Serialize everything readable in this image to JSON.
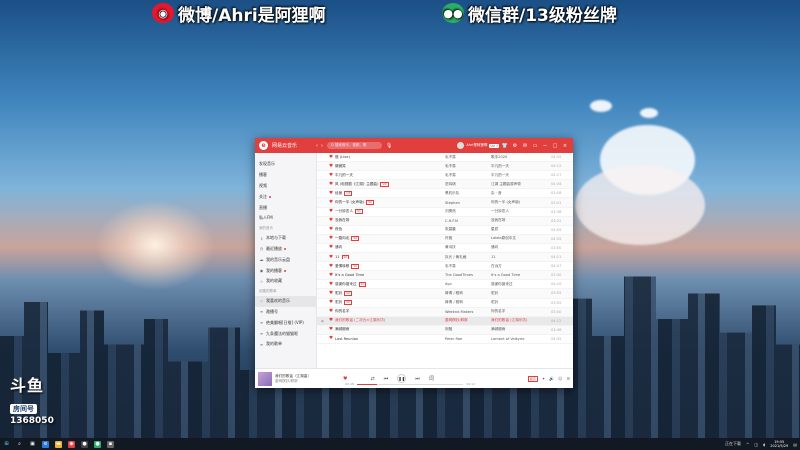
{
  "banner": {
    "weibo": "微博/Ahri是阿狸啊",
    "wechat": "微信群/13级粉丝牌"
  },
  "app": {
    "title": "网易云音乐",
    "search_placeholder": "Q 搜索音乐，视频，歌",
    "user_name": "Ahri是阿狸啊",
    "vip": "VIP 7",
    "accent": "#e13e3e"
  },
  "sidebar": {
    "items": [
      {
        "label": "发现音乐",
        "type": "nav"
      },
      {
        "label": "播客",
        "type": "nav"
      },
      {
        "label": "视频",
        "type": "nav"
      },
      {
        "label": "关注",
        "type": "nav",
        "dot": true
      },
      {
        "label": "直播",
        "type": "nav"
      },
      {
        "label": "私人FM",
        "type": "nav"
      },
      {
        "label": "我的音乐",
        "type": "group"
      },
      {
        "label": "本地与下载",
        "type": "mine",
        "icon": "download-icon"
      },
      {
        "label": "最近播放",
        "type": "mine",
        "icon": "clock-icon",
        "dot": true
      },
      {
        "label": "我的音乐云盘",
        "type": "mine",
        "icon": "cloud-icon"
      },
      {
        "label": "我的播客",
        "type": "mine",
        "icon": "podcast-icon",
        "dot": true
      },
      {
        "label": "我的收藏",
        "type": "mine",
        "icon": "star-icon"
      },
      {
        "label": "创建的歌单",
        "type": "group"
      },
      {
        "label": "我喜欢的音乐",
        "type": "mine",
        "icon": "heart-icon",
        "active": true
      },
      {
        "label": "邀播号",
        "type": "mine",
        "icon": "list-icon"
      },
      {
        "label": "绝美翻唱[日推] (VIP)",
        "type": "mine",
        "icon": "list-icon"
      },
      {
        "label": "九条魔法的猫猫呢",
        "type": "mine",
        "icon": "list-icon"
      },
      {
        "label": "我的歌单",
        "type": "mine",
        "icon": "list-icon"
      }
    ]
  },
  "songs": [
    {
      "idx": "",
      "title": "借 (Live)",
      "tag": "",
      "artist": "毛不易",
      "album": "歌手2020",
      "dur": "04:55"
    },
    {
      "idx": "",
      "title": "微微笑",
      "tag": "",
      "artist": "毛不易",
      "album": "平凡的一天",
      "dur": "04:12"
    },
    {
      "idx": "",
      "title": "平凡的一天",
      "tag": "",
      "artist": "毛不易",
      "album": "平凡的一天",
      "dur": "04:27"
    },
    {
      "idx": "",
      "title": "风 (电视剧《江湖》主题曲)",
      "tag": "VIP",
      "artist": "范玮琪",
      "album": "江湖 主题曲原声带",
      "dur": "04:34"
    },
    {
      "idx": "",
      "title": "经营",
      "tag": "VIP",
      "artist": "黑豹乐队",
      "album": "杂 · 音",
      "dur": "03:58"
    },
    {
      "idx": "",
      "title": "你的一半 (女声版)",
      "tag": "SQ",
      "artist": "Stephen",
      "album": "你的一半 (女声版)",
      "dur": "03:41"
    },
    {
      "idx": "",
      "title": "一分钟恋人",
      "tag": "SQ",
      "artist": "刘昊然",
      "album": "一分钟恋人",
      "dur": "03:38"
    },
    {
      "idx": "",
      "title": "没我在场",
      "tag": "",
      "artist": "C.H.F.N",
      "album": "没我在场",
      "dur": "03:22"
    },
    {
      "idx": "",
      "title": "夜色",
      "tag": "",
      "artist": "张碧晨",
      "album": "星辰",
      "dur": "04:05"
    },
    {
      "idx": "",
      "title": "一路向北",
      "tag": "SQ",
      "artist": "许嵩",
      "album": "Lalala原创中文",
      "dur": "04:55"
    },
    {
      "idx": "",
      "title": "通向",
      "tag": "",
      "artist": "黄诗扶",
      "album": "通向",
      "dur": "03:50"
    },
    {
      "idx": "",
      "title": "11",
      "tag": "SQ",
      "artist": "队长 / 黄礼格",
      "album": "11",
      "dur": "04:21"
    },
    {
      "idx": "",
      "title": "爱情转移",
      "tag": "SQ",
      "artist": "毛不易",
      "album": "在远方",
      "dur": "04:07"
    },
    {
      "idx": "",
      "title": "It's a Good Time",
      "tag": "",
      "artist": "The GoodTimes",
      "album": "It's a Good Time",
      "dur": "03:30"
    },
    {
      "idx": "",
      "title": "感谢你曾来过",
      "tag": "SQ",
      "artist": "Ayo",
      "album": "感谢你曾来过",
      "dur": "04:10"
    },
    {
      "idx": "",
      "title": "驼铃",
      "tag": "SQ",
      "artist": "蒋倩 / 程响",
      "album": "驼铃",
      "dur": "03:55"
    },
    {
      "idx": "",
      "title": "驼铃",
      "tag": "SQ",
      "artist": "蒋倩 / 程响",
      "album": "驼铃",
      "dur": "03:55"
    },
    {
      "idx": "",
      "title": "你的名字",
      "tag": "",
      "artist": "Weeknd Makers",
      "album": "你的名字",
      "dur": "03:40"
    },
    {
      "idx": "",
      "title": "我们的歌谣 (二次元×江湖乐坊)",
      "tag": "",
      "artist": "墨明棋妙/胖胖",
      "album": "我们的歌谣 (江湖乐坊)",
      "dur": "04:12",
      "playing": true
    },
    {
      "idx": "",
      "title": "满城烟雨",
      "tag": "",
      "artist": "祝融",
      "album": "满城烟雨",
      "dur": "03:48"
    },
    {
      "idx": "",
      "title": "Last Reunion",
      "tag": "",
      "artist": "Peter Roe",
      "album": "Lament of Valkyrie",
      "dur": "04:35"
    }
  ],
  "player": {
    "song": "我们的歌谣（江湖曲）",
    "artist": "墨明棋妙/胖胖",
    "time_current": "00:48",
    "time_total": "04:12",
    "progress": 0.19,
    "quality": "极高"
  },
  "douyu": {
    "logo": "斗鱼",
    "room_label": "房间号",
    "room_id": "1368050"
  },
  "taskbar": {
    "tray_text": "正在下载",
    "time": "19:55",
    "date": "2021/5/29"
  }
}
